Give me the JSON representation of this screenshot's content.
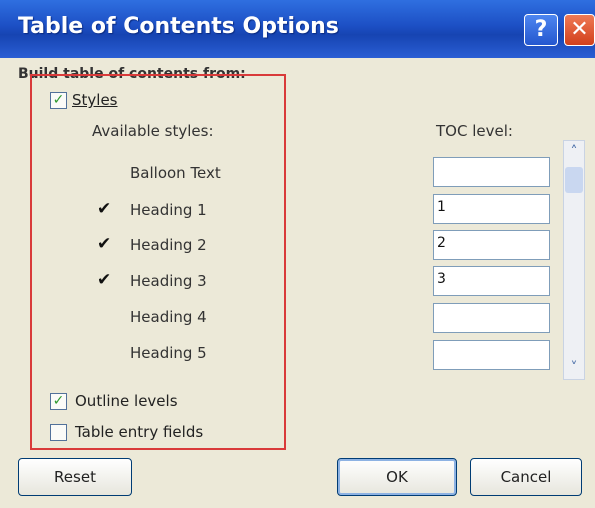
{
  "dialog": {
    "title": "Table of Contents Options",
    "help_glyph": "?",
    "close_glyph": "✕"
  },
  "build_from": {
    "label": "Build table of contents from:"
  },
  "styles_option": {
    "label": "Styles",
    "checked": true,
    "check_glyph": "✓"
  },
  "columns": {
    "available": "Available styles:",
    "toc_level": "TOC level:"
  },
  "styles": [
    {
      "name": "Balloon Text",
      "level": "",
      "mark": ""
    },
    {
      "name": "Heading 1",
      "level": "1",
      "mark": "✔"
    },
    {
      "name": "Heading 2",
      "level": "2",
      "mark": "✔"
    },
    {
      "name": "Heading 3",
      "level": "3",
      "mark": "✔"
    },
    {
      "name": "Heading 4",
      "level": "",
      "mark": ""
    },
    {
      "name": "Heading 5",
      "level": "",
      "mark": ""
    }
  ],
  "scrollbar": {
    "up_glyph": "˄",
    "down_glyph": "˅"
  },
  "outline_levels": {
    "label": "Outline levels",
    "checked": true,
    "check_glyph": "✓"
  },
  "table_entry_fields": {
    "label": "Table entry fields",
    "checked": false,
    "check_glyph": ""
  },
  "buttons": {
    "reset": "Reset",
    "ok": "OK",
    "cancel": "Cancel"
  },
  "colors": {
    "title_bar": "#1c4fc4",
    "highlight_frame": "#d93a3a",
    "dialog_bg": "#ece9d8"
  }
}
